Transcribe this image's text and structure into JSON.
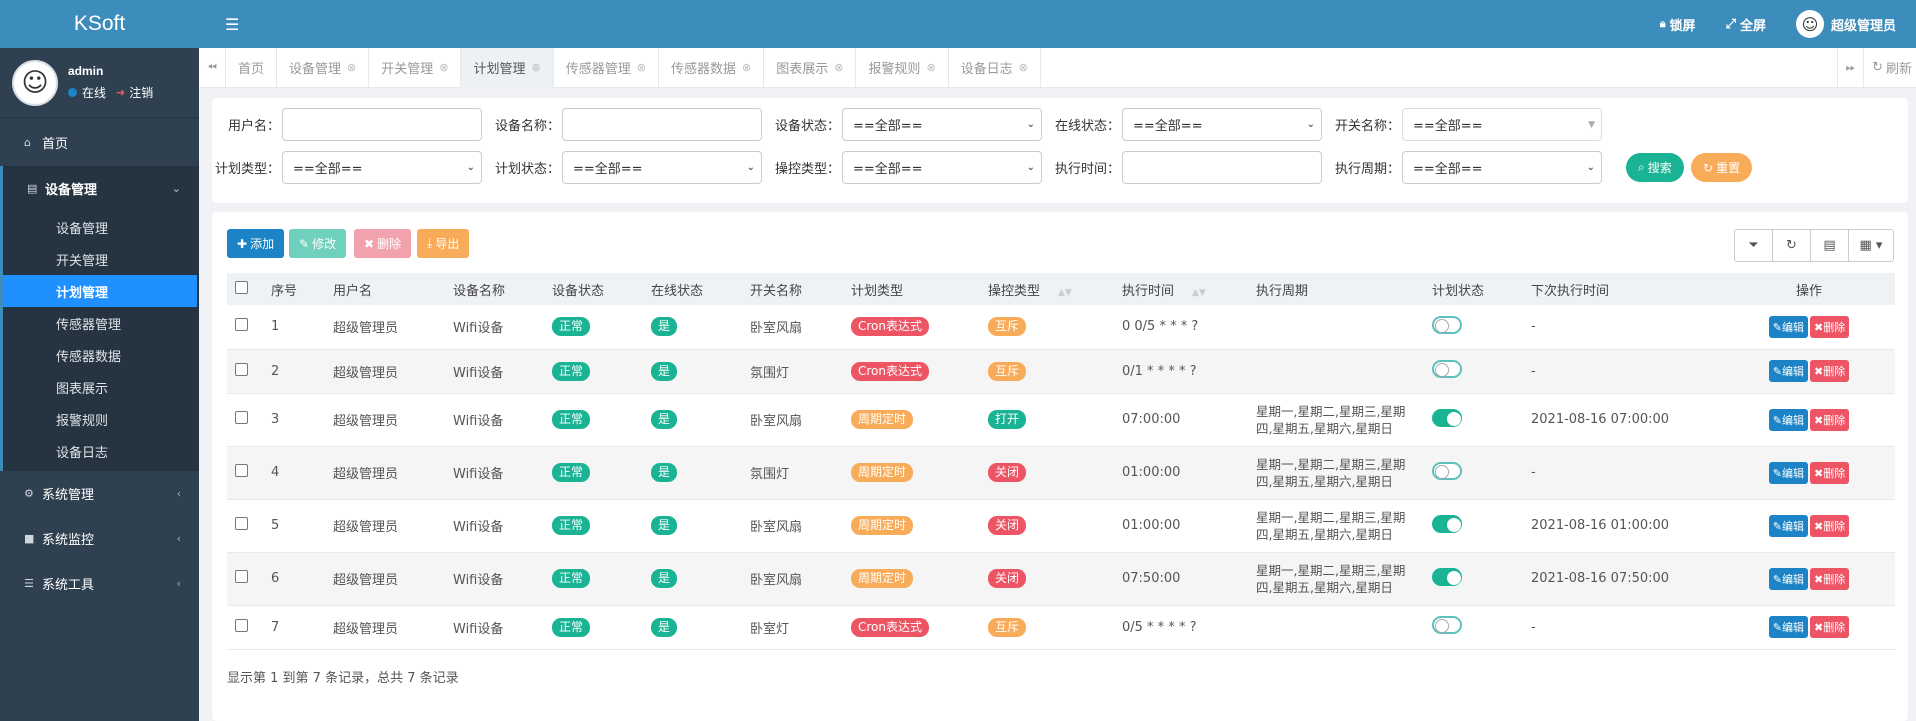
{
  "app": {
    "brand": "KSoft"
  },
  "user": {
    "name": "admin",
    "status": "在线",
    "logout": "注销"
  },
  "sidebar": {
    "home": "首页",
    "device_group": "设备管理",
    "sub_items": [
      "设备管理",
      "开关管理",
      "计划管理",
      "传感器管理",
      "传感器数据",
      "图表展示",
      "报警规则",
      "设备日志"
    ],
    "system_manage": "系统管理",
    "system_monitor": "系统监控",
    "system_tools": "系统工具"
  },
  "header": {
    "lock": "锁屏",
    "fullscreen": "全屏",
    "account": "超级管理员"
  },
  "tabs": [
    "首页",
    "设备管理",
    "开关管理",
    "计划管理",
    "传感器管理",
    "传感器数据",
    "图表展示",
    "报警规则",
    "设备日志"
  ],
  "tabbar": {
    "refresh": "刷新"
  },
  "search": {
    "username_label": "用户名：",
    "device_name_label": "设备名称：",
    "device_status_label": "设备状态：",
    "online_status_label": "在线状态：",
    "switch_name_label": "开关名称：",
    "plan_type_label": "计划类型：",
    "plan_status_label": "计划状态：",
    "control_type_label": "操控类型：",
    "exec_time_label": "执行时间：",
    "exec_period_label": "执行周期：",
    "all_option": "==全部==",
    "search_btn": "搜索",
    "reset_btn": "重置"
  },
  "toolbar": {
    "add": "添加",
    "edit": "修改",
    "delete": "删除",
    "export": "导出"
  },
  "table": {
    "headers": [
      "序号",
      "用户名",
      "设备名称",
      "设备状态",
      "在线状态",
      "开关名称",
      "计划类型",
      "操控类型",
      "执行时间",
      "执行周期",
      "计划状态",
      "下次执行时间",
      "操作"
    ],
    "op_edit": "编辑",
    "op_delete": "删除",
    "rows": [
      {
        "no": "1",
        "user": "超级管理员",
        "device": "Wifi设备",
        "dev_status": "正常",
        "online": "是",
        "switch": "卧室风扇",
        "plan_type": "Cron表达式",
        "plan_type_color": "red",
        "control": "互斥",
        "control_color": "orange",
        "exec_time": "0 0/5 * * * ?",
        "period": "",
        "plan_on": false,
        "next_time": "-"
      },
      {
        "no": "2",
        "user": "超级管理员",
        "device": "Wifi设备",
        "dev_status": "正常",
        "online": "是",
        "switch": "氛围灯",
        "plan_type": "Cron表达式",
        "plan_type_color": "red",
        "control": "互斥",
        "control_color": "orange",
        "exec_time": "0/1 * * * * ?",
        "period": "",
        "plan_on": false,
        "next_time": "-"
      },
      {
        "no": "3",
        "user": "超级管理员",
        "device": "Wifi设备",
        "dev_status": "正常",
        "online": "是",
        "switch": "卧室风扇",
        "plan_type": "周期定时",
        "plan_type_color": "orange",
        "control": "打开",
        "control_color": "green",
        "exec_time": "07:00:00",
        "period": "星期一,星期二,星期三,星期四,星期五,星期六,星期日",
        "plan_on": true,
        "next_time": "2021-08-16 07:00:00"
      },
      {
        "no": "4",
        "user": "超级管理员",
        "device": "Wifi设备",
        "dev_status": "正常",
        "online": "是",
        "switch": "氛围灯",
        "plan_type": "周期定时",
        "plan_type_color": "orange",
        "control": "关闭",
        "control_color": "red",
        "exec_time": "01:00:00",
        "period": "星期一,星期二,星期三,星期四,星期五,星期六,星期日",
        "plan_on": false,
        "next_time": "-"
      },
      {
        "no": "5",
        "user": "超级管理员",
        "device": "Wifi设备",
        "dev_status": "正常",
        "online": "是",
        "switch": "卧室风扇",
        "plan_type": "周期定时",
        "plan_type_color": "orange",
        "control": "关闭",
        "control_color": "red",
        "exec_time": "01:00:00",
        "period": "星期一,星期二,星期三,星期四,星期五,星期六,星期日",
        "plan_on": true,
        "next_time": "2021-08-16 01:00:00"
      },
      {
        "no": "6",
        "user": "超级管理员",
        "device": "Wifi设备",
        "dev_status": "正常",
        "online": "是",
        "switch": "卧室风扇",
        "plan_type": "周期定时",
        "plan_type_color": "orange",
        "control": "关闭",
        "control_color": "red",
        "exec_time": "07:50:00",
        "period": "星期一,星期二,星期三,星期四,星期五,星期六,星期日",
        "plan_on": true,
        "next_time": "2021-08-16 07:50:00"
      },
      {
        "no": "7",
        "user": "超级管理员",
        "device": "Wifi设备",
        "dev_status": "正常",
        "online": "是",
        "switch": "卧室灯",
        "plan_type": "Cron表达式",
        "plan_type_color": "red",
        "control": "互斥",
        "control_color": "orange",
        "exec_time": "0/5 * * * * ?",
        "period": "",
        "plan_on": false,
        "next_time": "-"
      }
    ],
    "footer": "显示第 1 到第 7 条记录，总共 7 条记录"
  },
  "colors": {
    "primary": "#3c8dbc",
    "sidebar": "#2f4050",
    "green": "#1ab394",
    "red": "#ed5565",
    "orange": "#f8ac59",
    "blue": "#1c84c6"
  }
}
